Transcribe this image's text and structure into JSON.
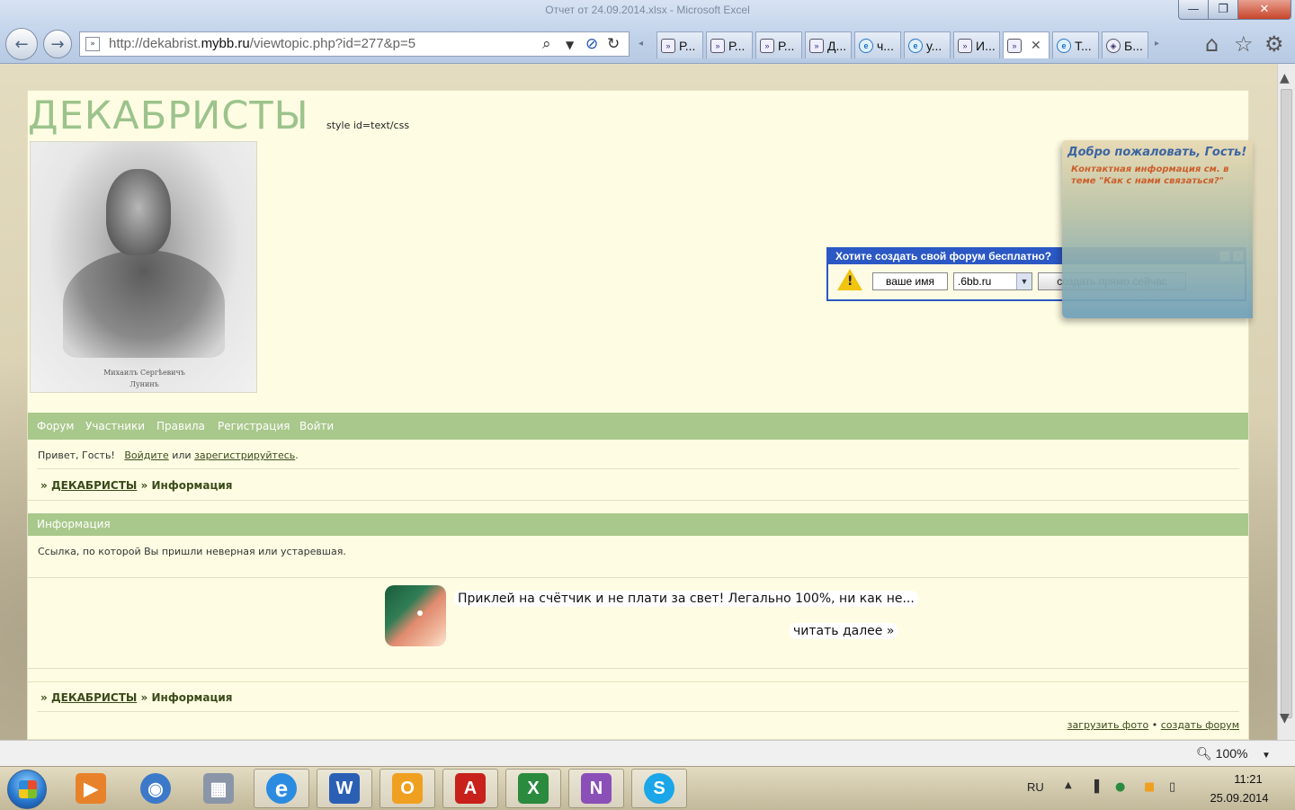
{
  "window": {
    "title": "Отчет от 24.09.2014.xlsx - Microsoft Excel",
    "minimize_icon": "minimize-icon",
    "maximize_icon": "maximize-icon",
    "close_icon": "close-icon"
  },
  "browser": {
    "url_prefix": "http://dekabrist.",
    "url_domain": "mybb.ru",
    "url_rest": "/viewtopic.php?id=277&p=5",
    "tabs": [
      {
        "label": "Р...",
        "icon": "mybb-icon"
      },
      {
        "label": "Р...",
        "icon": "mybb-icon"
      },
      {
        "label": "Р...",
        "icon": "mybb-icon"
      },
      {
        "label": "Д...",
        "icon": "mybb-icon"
      },
      {
        "label": "ч...",
        "icon": "ie-icon"
      },
      {
        "label": "у...",
        "icon": "ie-icon"
      },
      {
        "label": "И...",
        "icon": "mybb-icon"
      },
      {
        "label": "",
        "icon": "mybb-icon"
      },
      {
        "label": "Т...",
        "icon": "ie-icon"
      },
      {
        "label": "Б...",
        "icon": "compass-icon"
      }
    ],
    "zoom": "100%"
  },
  "forum": {
    "title": "ДЕКАБРИСТЫ",
    "style_note": "style id=text/css",
    "portrait_caption_line1": "Михаилъ Сергѣевичъ",
    "portrait_caption_line2": "Лунинъ",
    "nav": [
      "Форум",
      "Участники",
      "Правила",
      "Регистрация",
      "Войти"
    ],
    "greeting": "Привет, Гость!",
    "login_link": "Войдите",
    "or_text": "или",
    "register_link": "зарегистрируйтесь",
    "period": ".",
    "crumb_sep": "»",
    "crumb_root": "ДЕКАБРИСТЫ",
    "crumb_current": "Информация",
    "info_heading": "Информация",
    "info_message": "Ссылка, по которой Вы пришли неверная или устаревшая.",
    "ad_text": "Приклей на счётчик и не плати за свет! Легально 100%, ни как не...",
    "ad_more": "читать далее »",
    "footer_upload": "загрузить фото",
    "footer_bullet": "•",
    "footer_create": "создать форум"
  },
  "create_popup": {
    "title": "Хотите создать свой форум бесплатно?",
    "name_placeholder": "ваше имя",
    "domain_value": ".6bb.ru",
    "create_button": "создать прямо сейчас"
  },
  "welcome_panel": {
    "title": "Добро пожаловать, Гость!",
    "contact": "Контактная информация см. в теме \"Как с нами связаться?\""
  },
  "taskbar": {
    "language": "RU",
    "time": "11:21",
    "date": "25.09.2014",
    "apps": [
      {
        "name": "media-player",
        "glyph": "▶",
        "color": "#e8822a"
      },
      {
        "name": "media-center",
        "glyph": "◉",
        "color": "#3c79c8"
      },
      {
        "name": "calculator",
        "glyph": "▦",
        "color": "#8a96a8"
      },
      {
        "name": "internet-explorer",
        "glyph": "e",
        "color": "#2b8be0"
      },
      {
        "name": "word",
        "glyph": "W",
        "color": "#2b5fb4"
      },
      {
        "name": "outlook",
        "glyph": "O",
        "color": "#f0a020"
      },
      {
        "name": "acrobat",
        "glyph": "A",
        "color": "#c8201a"
      },
      {
        "name": "excel",
        "glyph": "X",
        "color": "#2a8a3e"
      },
      {
        "name": "onenote",
        "glyph": "N",
        "color": "#8b4fb8"
      },
      {
        "name": "skype",
        "glyph": "S",
        "color": "#1aa6e8"
      }
    ]
  }
}
